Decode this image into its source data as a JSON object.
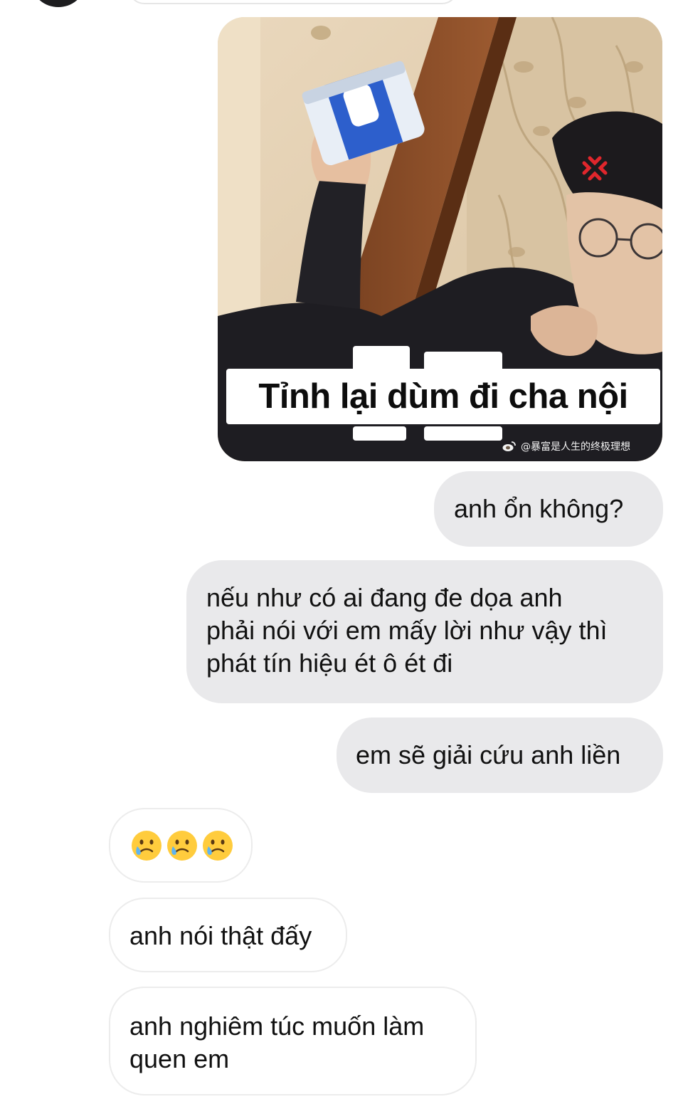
{
  "meme": {
    "caption": "Tỉnh lại dùm đi cha nội",
    "watermark": "@暴富是人生的终极理想"
  },
  "messages": [
    {
      "side": "sent",
      "text": "anh ổn không?"
    },
    {
      "side": "sent",
      "text": "nếu như có ai đang đe dọa anh\nphải nói với em mấy lời như vậy thì\nphát tín hiệu ét ô ét đi"
    },
    {
      "side": "sent",
      "text": "em sẽ giải cứu anh liền"
    },
    {
      "side": "received",
      "emoji": [
        "smiling-face-with-tear",
        "smiling-face-with-tear",
        "smiling-face-with-tear"
      ]
    },
    {
      "side": "received",
      "text": "anh nói thật đấy"
    },
    {
      "side": "received",
      "text": "anh nghiêm túc muốn làm\nquen em"
    }
  ],
  "colors": {
    "sent_bubble": "#e9e9eb",
    "received_border": "#ececec",
    "background": "#ffffff"
  }
}
